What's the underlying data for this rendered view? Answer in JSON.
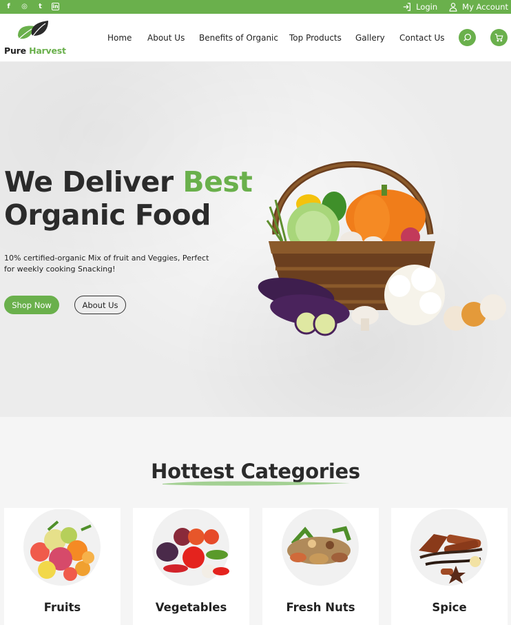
{
  "topbar": {
    "social": [
      {
        "icon": "facebook-icon",
        "glyph": "f"
      },
      {
        "icon": "instagram-icon",
        "glyph": "◎"
      },
      {
        "icon": "twitter-icon",
        "glyph": "t"
      },
      {
        "icon": "linkedin-icon",
        "glyph": "in"
      }
    ],
    "login_label": "Login",
    "account_label": "My Account"
  },
  "header": {
    "logo": {
      "part1": "Pure",
      "part2": "Harvest"
    },
    "nav": [
      "Home",
      "About Us",
      "Benefits of Organic",
      "Top Products",
      "Gallery",
      "Contact Us"
    ]
  },
  "hero": {
    "headline_part1": "We Deliver ",
    "headline_highlight": "Best",
    "headline_line2": "Organic Food",
    "description": "10% certified-organic Mix of fruit and Veggies, Perfect for weekly cooking Snacking!",
    "shop_button": "Shop Now",
    "about_button": "About Us"
  },
  "categories": {
    "title_regular": "Hottest ",
    "title_bold": "Categories",
    "items": [
      {
        "label": "Fruits"
      },
      {
        "label": "Vegetables"
      },
      {
        "label": "Fresh Nuts"
      },
      {
        "label": "Spice"
      }
    ]
  },
  "colors": {
    "accent": "#6ab04c",
    "dark_text": "#2b2b2b"
  }
}
